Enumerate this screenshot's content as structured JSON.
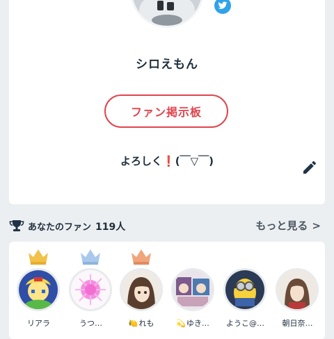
{
  "profile": {
    "username": "シロえもん",
    "fan_board_label": "ファン掲示板",
    "bio_prefix": "よろしく",
    "bio_mark": "❗",
    "bio_suffix": "(￣▽￣)"
  },
  "fans": {
    "title": "あなたのファン",
    "count": "119人",
    "more_label": "もっと見る",
    "items": [
      {
        "name": "リアラ",
        "prefix": "",
        "crown": "gold"
      },
      {
        "name": "うつ…",
        "prefix": "",
        "crown": "silver"
      },
      {
        "name": "れも",
        "prefix": "🍋",
        "crown": "bronze"
      },
      {
        "name": "ゆき…",
        "prefix": "💫",
        "crown": ""
      },
      {
        "name": "ようこ@…",
        "prefix": "",
        "crown": ""
      },
      {
        "name": "朝日奈…",
        "prefix": "",
        "crown": ""
      }
    ]
  },
  "colors": {
    "accent_red": "#e0444d",
    "twitter_blue": "#2fa3ea",
    "gold": "#f2c14a",
    "silver": "#a9c9ec",
    "bronze": "#f0a57c"
  }
}
